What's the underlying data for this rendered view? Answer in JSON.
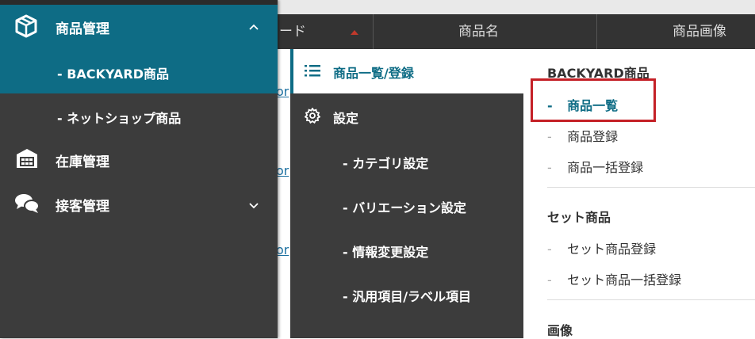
{
  "background_table": {
    "header_partial": "ード",
    "col_name": "商品名",
    "col_image": "商品画像",
    "row_link": "or"
  },
  "sidebar": {
    "product_mgmt": "商品管理",
    "sub_backyard": "- BACKYARD商品",
    "sub_netshop": "- ネットショップ商品",
    "inventory_mgmt": "在庫管理",
    "customer_mgmt": "接客管理"
  },
  "submenu": {
    "list_register": "商品一覧/登録",
    "settings": "設定",
    "category": "- カテゴリ設定",
    "variation": "- バリエーション設定",
    "info_change": "- 情報変更設定",
    "generic_label": "- 汎用項目/ラベル項目"
  },
  "flyout": {
    "backyard_head": "BACKYARD商品",
    "item_list": "商品一覧",
    "item_register": "商品登録",
    "item_bulk_register": "商品一括登録",
    "set_head": "セット商品",
    "set_register": "セット商品登録",
    "set_bulk_register": "セット商品一括登録",
    "image_head": "画像"
  },
  "colors": {
    "accent": "#0e6c85",
    "sidebar_bg": "#3c3c3c",
    "highlight": "#c42026",
    "sort_arrow": "#c0392b"
  }
}
